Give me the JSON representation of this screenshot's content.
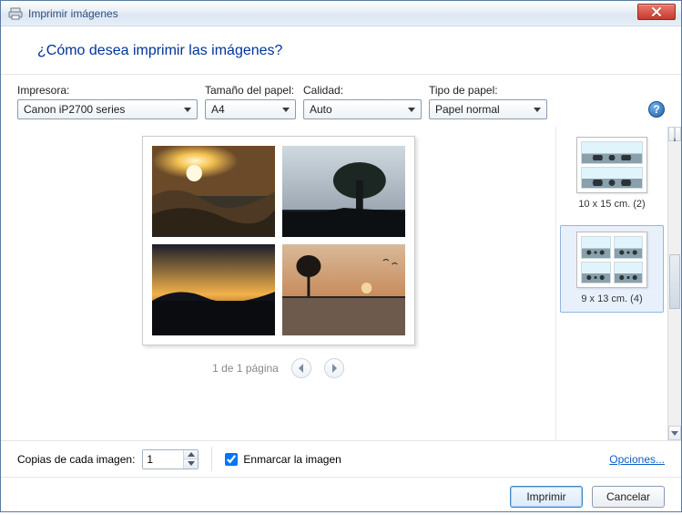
{
  "window": {
    "title": "Imprimir imágenes"
  },
  "header": {
    "question": "¿Cómo desea imprimir las imágenes?"
  },
  "settings": {
    "printer_label": "Impresora:",
    "printer_value": "Canon iP2700 series",
    "paper_size_label": "Tamaño del papel:",
    "paper_size_value": "A4",
    "quality_label": "Calidad:",
    "quality_value": "Auto",
    "paper_type_label": "Tipo de papel:",
    "paper_type_value": "Papel normal"
  },
  "pager": {
    "text": "1 de 1 página"
  },
  "layouts": {
    "opt1_label": "10 x 15 cm. (2)",
    "opt2_label": "9 x 13 cm. (4)"
  },
  "footer": {
    "copies_label": "Copias de cada imagen:",
    "copies_value": "1",
    "fit_label": "Enmarcar la imagen",
    "options_link": "Opciones...",
    "print_btn": "Imprimir",
    "cancel_btn": "Cancelar"
  }
}
